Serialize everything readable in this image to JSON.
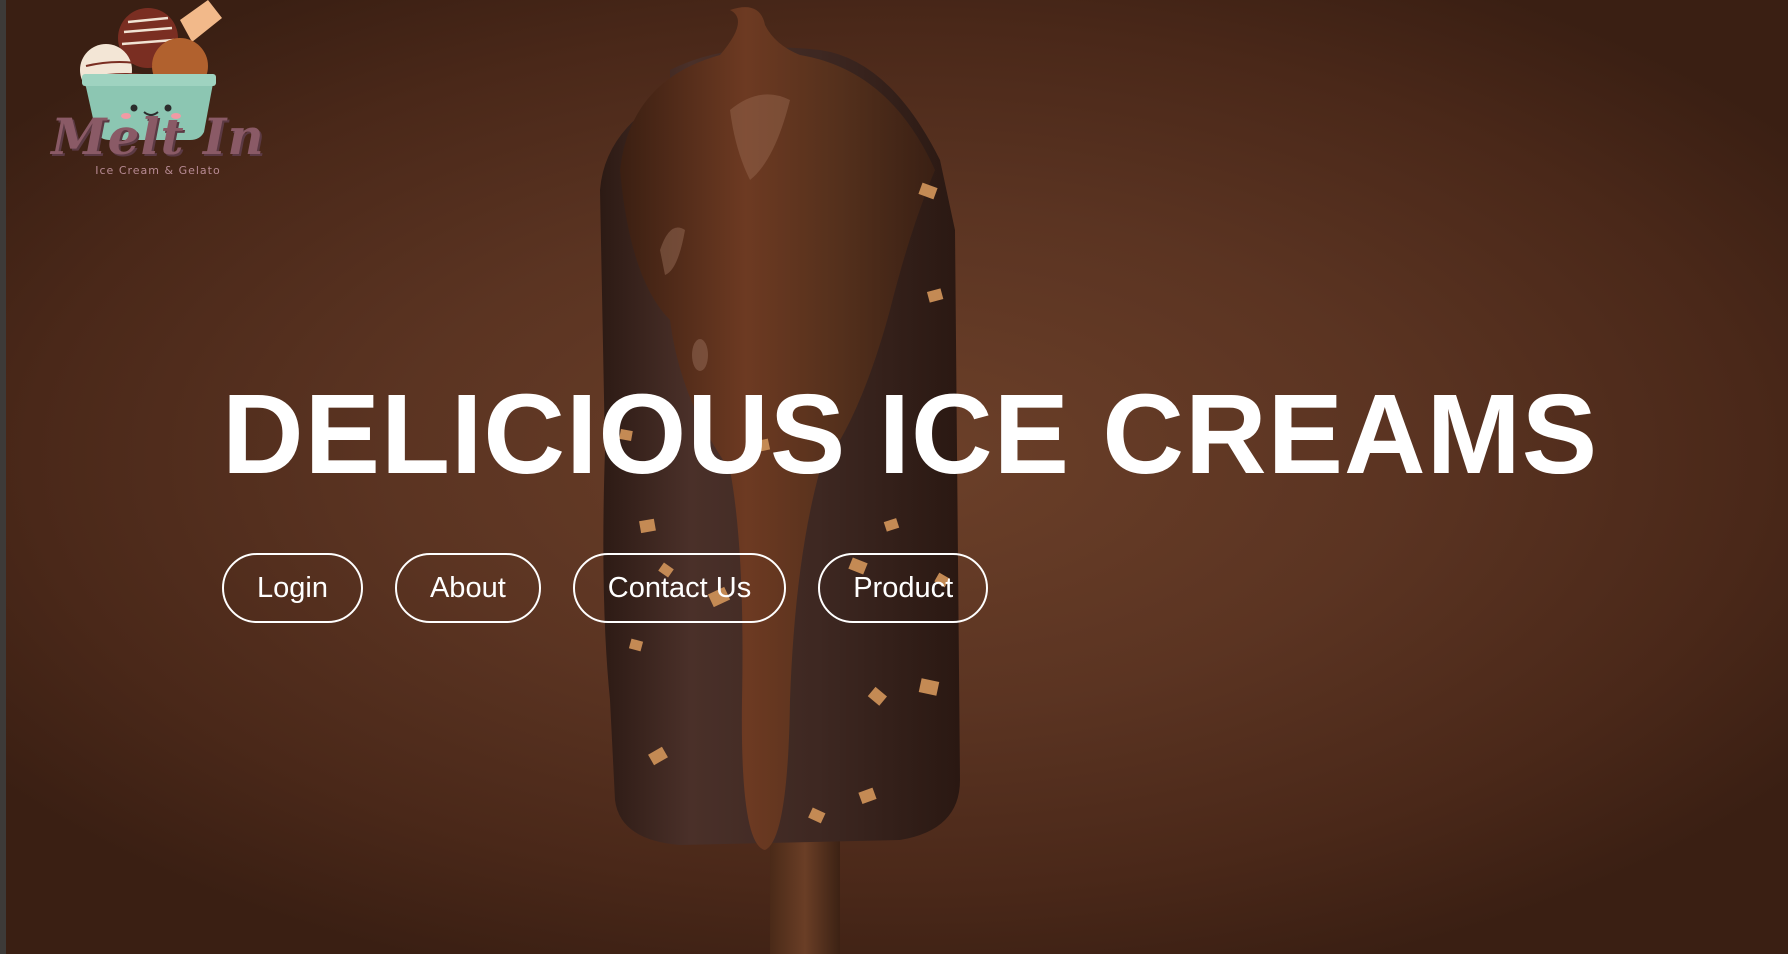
{
  "logo": {
    "title": "Melt In",
    "subtitle": "Ice Cream & Gelato",
    "icon": "ice-cream-cup-icon"
  },
  "hero": {
    "headline": "DELICIOUS ICE CREAMS",
    "background_image": "chocolate-popsicle-image"
  },
  "nav": {
    "login_label": "Login",
    "about_label": "About",
    "contact_label": "Contact Us",
    "product_label": "Product"
  },
  "colors": {
    "background": "#5b3422",
    "text": "#ffffff",
    "button_border": "#ffffff"
  }
}
